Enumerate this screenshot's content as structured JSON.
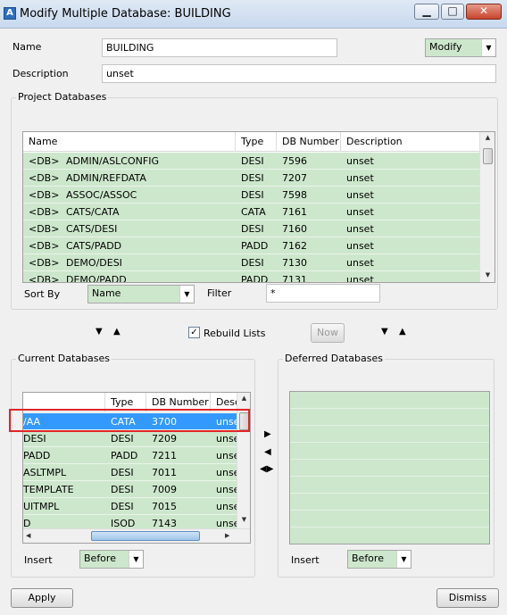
{
  "window": {
    "app_icon": "app-logo-icon",
    "title": "Modify Multiple Database: BUILDING",
    "buttons": [
      "minimize-icon",
      "maximize-icon",
      "close-icon"
    ]
  },
  "form": {
    "name_label": "Name",
    "name_value": "BUILDING",
    "description_label": "Description",
    "description_value": "unset",
    "mode_value": "Modify"
  },
  "project_databases": {
    "title": "Project Databases",
    "columns": [
      "Name",
      "Type",
      "DB Number",
      "Description"
    ],
    "rows": [
      {
        "tag": "<DB>",
        "name": "ADMIN/ASLCONFIG",
        "type": "DESI",
        "number": "7596",
        "desc": "unset"
      },
      {
        "tag": "<DB>",
        "name": "ADMIN/REFDATA",
        "type": "DESI",
        "number": "7207",
        "desc": "unset"
      },
      {
        "tag": "<DB>",
        "name": "ASSOC/ASSOC",
        "type": "DESI",
        "number": "7598",
        "desc": "unset"
      },
      {
        "tag": "<DB>",
        "name": "CATS/CATA",
        "type": "CATA",
        "number": "7161",
        "desc": "unset"
      },
      {
        "tag": "<DB>",
        "name": "CATS/DESI",
        "type": "DESI",
        "number": "7160",
        "desc": "unset"
      },
      {
        "tag": "<DB>",
        "name": "CATS/PADD",
        "type": "PADD",
        "number": "7162",
        "desc": "unset"
      },
      {
        "tag": "<DB>",
        "name": "DEMO/DESI",
        "type": "DESI",
        "number": "7130",
        "desc": "unset"
      },
      {
        "tag": "<DB>",
        "name": "DEMO/PADD",
        "type": "PADD",
        "number": "7131",
        "desc": "unset"
      }
    ],
    "sort_by_label": "Sort By",
    "sort_by_value": "Name",
    "filter_label": "Filter",
    "filter_value": "*"
  },
  "middle": {
    "rebuild_label": "Rebuild Lists",
    "rebuild_checked": true,
    "now_label": "Now"
  },
  "current_databases": {
    "title": "Current Databases",
    "columns": [
      "",
      "Type",
      "DB Number",
      "Desc"
    ],
    "rows": [
      {
        "name": "/AA",
        "type": "CATA",
        "number": "3700",
        "desc": "unset",
        "selected": true
      },
      {
        "name": "DESI",
        "type": "DESI",
        "number": "7209",
        "desc": "unset"
      },
      {
        "name": "PADD",
        "type": "PADD",
        "number": "7211",
        "desc": "unset"
      },
      {
        "name": "ASLTMPL",
        "type": "DESI",
        "number": "7011",
        "desc": "unset"
      },
      {
        "name": "TEMPLATE",
        "type": "DESI",
        "number": "7009",
        "desc": "unset"
      },
      {
        "name": "UITMPL",
        "type": "DESI",
        "number": "7015",
        "desc": "unset"
      },
      {
        "name": "D",
        "type": "ISOD",
        "number": "7143",
        "desc": "unset"
      }
    ],
    "insert_label": "Insert",
    "insert_value": "Before"
  },
  "deferred_databases": {
    "title": "Deferred Databases",
    "insert_label": "Insert",
    "insert_value": "Before"
  },
  "footer": {
    "apply_label": "Apply",
    "dismiss_label": "Dismiss"
  },
  "colors": {
    "list_green": "#cde7cc",
    "selection_blue": "#3399ff",
    "highlight_red": "#e0252a"
  }
}
